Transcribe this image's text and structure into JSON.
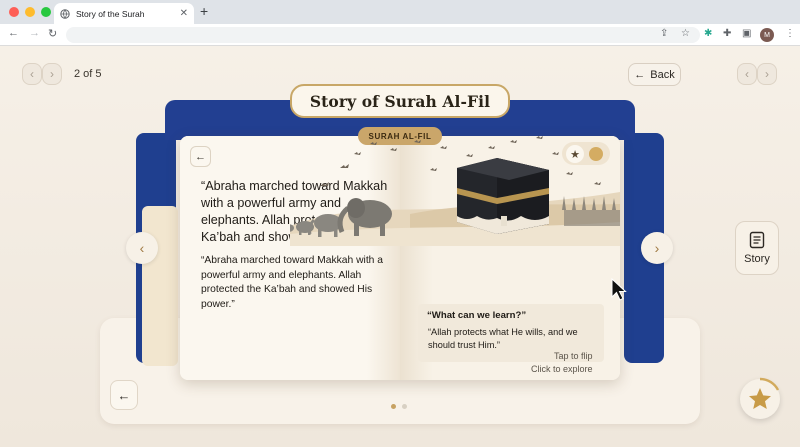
{
  "browser": {
    "tab_title": "Story of the Surah",
    "new_tab": "+",
    "close": "✕",
    "avatar": "M"
  },
  "toolbar": {
    "counter": "2 of 5",
    "back_label": "Back"
  },
  "book": {
    "title": "Story of Surah Al-Fil",
    "tag": "SURAH AL-FIL",
    "quote_large": "“Abraha marched toward Makkah with a powerful army and elephants. Allah protected the Ka’bah and shower.",
    "quote_small": "“Abraha marched toward Makkah with a powerful army and elephants. Allah protected the Ka’bah and showed His power.”",
    "learn_title": "“What can we learn?”",
    "learn_text": "“Allah protects what He wills, and we should trust Him.”",
    "hint_flip": "Tap to flip",
    "hint_explore": "Click to explore"
  },
  "side": {
    "story_label": "Story"
  },
  "pager": {
    "total": 2,
    "active": 0
  },
  "icons": {
    "left": "‹",
    "right": "›",
    "arrow_left": "←",
    "star": "★"
  },
  "colors": {
    "accent_gold": "#c8a767",
    "navy": "#223f91",
    "background": "#f4ede3"
  }
}
